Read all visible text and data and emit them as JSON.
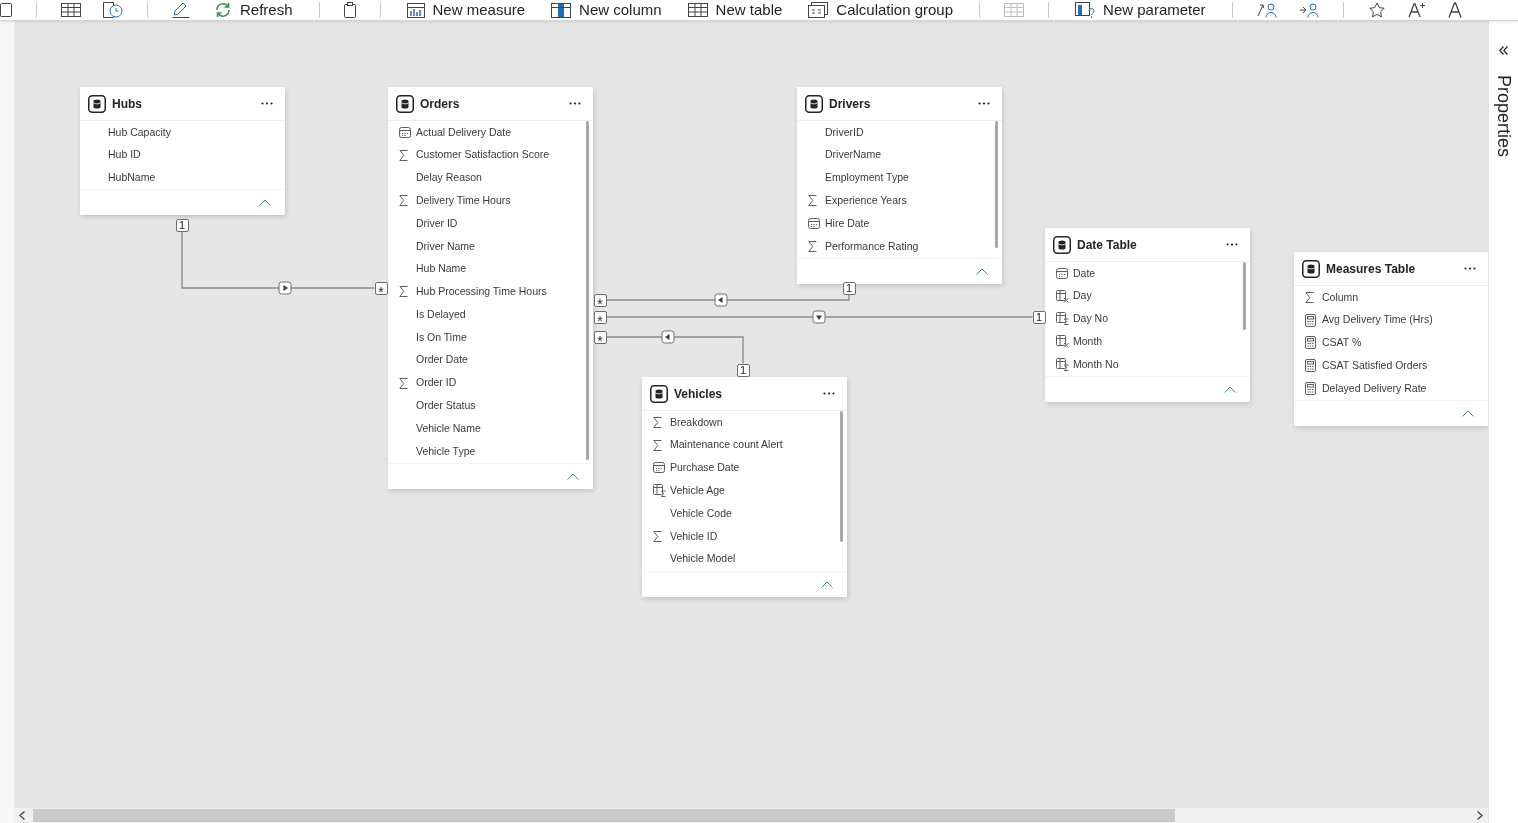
{
  "toolbar": {
    "groups": [
      {
        "items": [
          {
            "disabled": false
          }
        ]
      },
      {
        "items": [
          {
            "disabled": false
          },
          {
            "disabled": false
          }
        ]
      },
      {
        "items": [
          {
            "disabled": false
          },
          {
            "label": "Refresh",
            "disabled": false
          }
        ]
      },
      {
        "items": [
          {
            "disabled": false
          }
        ]
      },
      {
        "items": [
          {
            "label": "New measure",
            "disabled": false
          },
          {
            "label": "New column",
            "disabled": false
          },
          {
            "label": "New table",
            "disabled": false
          },
          {
            "label": "Calculation group",
            "disabled": false
          }
        ]
      },
      {
        "items": [
          {
            "disabled": true
          }
        ]
      },
      {
        "items": [
          {
            "label": "New parameter",
            "disabled": false
          }
        ]
      },
      {
        "items": [
          {
            "disabled": false
          },
          {
            "disabled": false
          }
        ]
      },
      {
        "items": [
          {
            "disabled": false
          },
          {
            "disabled": false
          },
          {
            "disabled": false
          }
        ]
      }
    ]
  },
  "tables": [
    {
      "title": "Hubs",
      "fields": [
        {
          "name": "Hub Capacity",
          "kind": "text"
        },
        {
          "name": "Hub ID",
          "kind": "text"
        },
        {
          "name": "HubName",
          "kind": "text"
        }
      ]
    },
    {
      "title": "Orders",
      "fields": [
        {
          "name": "Actual Delivery Date",
          "kind": "date"
        },
        {
          "name": "Customer Satisfaction Score",
          "kind": "sum"
        },
        {
          "name": "Delay Reason",
          "kind": "text"
        },
        {
          "name": "Delivery Time Hours",
          "kind": "sum"
        },
        {
          "name": "Driver ID",
          "kind": "text"
        },
        {
          "name": "Driver Name",
          "kind": "text"
        },
        {
          "name": "Hub Name",
          "kind": "text"
        },
        {
          "name": "Hub Processing Time Hours",
          "kind": "sum"
        },
        {
          "name": "Is Delayed",
          "kind": "text"
        },
        {
          "name": "Is On Time",
          "kind": "text"
        },
        {
          "name": "Order Date",
          "kind": "text"
        },
        {
          "name": "Order ID",
          "kind": "sum"
        },
        {
          "name": "Order Status",
          "kind": "text"
        },
        {
          "name": "Vehicle Name",
          "kind": "text"
        },
        {
          "name": "Vehicle Type",
          "kind": "text"
        }
      ]
    },
    {
      "title": "Drivers",
      "fields": [
        {
          "name": "DriverID",
          "kind": "text"
        },
        {
          "name": "DriverName",
          "kind": "text"
        },
        {
          "name": "Employment Type",
          "kind": "text"
        },
        {
          "name": "Experience Years",
          "kind": "sum"
        },
        {
          "name": "Hire Date",
          "kind": "date"
        },
        {
          "name": "Performance Rating",
          "kind": "sum"
        }
      ]
    },
    {
      "title": "Date Table",
      "fields": [
        {
          "name": "Date",
          "kind": "date"
        },
        {
          "name": "Day",
          "kind": "calc_text"
        },
        {
          "name": "Day No",
          "kind": "calc_sum"
        },
        {
          "name": "Month",
          "kind": "calc_text"
        },
        {
          "name": "Month No",
          "kind": "calc_sum"
        }
      ]
    },
    {
      "title": "Measures Table",
      "fields": [
        {
          "name": "Column",
          "kind": "sum"
        },
        {
          "name": "Avg Delivery Time (Hrs)",
          "kind": "measure"
        },
        {
          "name": "CSAT %",
          "kind": "measure"
        },
        {
          "name": "CSAT Satisfied Orders",
          "kind": "measure"
        },
        {
          "name": "Delayed Delivery Rate",
          "kind": "measure"
        }
      ]
    },
    {
      "title": "Vehicles",
      "fields": [
        {
          "name": "Breakdown",
          "kind": "sum"
        },
        {
          "name": "Maintenance count Alert",
          "kind": "sum"
        },
        {
          "name": "Purchase Date",
          "kind": "date"
        },
        {
          "name": "Vehicle Age",
          "kind": "calc_sum"
        },
        {
          "name": "Vehicle Code",
          "kind": "text"
        },
        {
          "name": "Vehicle ID",
          "kind": "sum"
        },
        {
          "name": "Vehicle Model",
          "kind": "text"
        }
      ]
    }
  ],
  "relationships": [
    {
      "one_end": "1",
      "many_end": "*",
      "kind": "right"
    },
    {
      "one_end": "1",
      "many_end": "*",
      "kind": "left"
    },
    {
      "one_end": "1",
      "many_end": "*",
      "kind": "down"
    },
    {
      "one_end": "1",
      "many_end": "*",
      "kind": "left"
    }
  ],
  "properties_pane": {
    "title": "Properties"
  }
}
